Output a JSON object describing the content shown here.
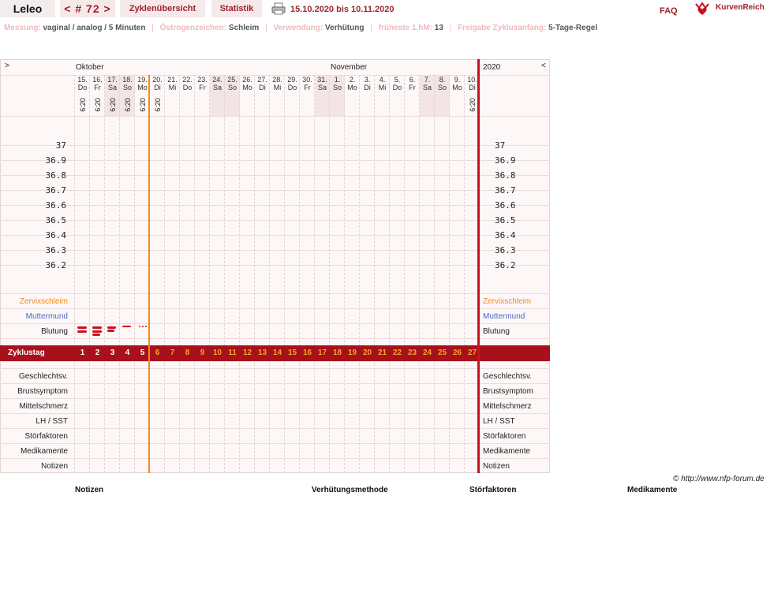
{
  "nav": {
    "user": "Leleo",
    "cycle": "< # 72 >",
    "overview": "Zyklenübersicht",
    "stats": "Statistik",
    "date_range": "15.10.2020 bis 10.11.2020",
    "faq": "FAQ",
    "logo": "KurvenReich"
  },
  "info": [
    {
      "key": "Messung:",
      "value": "vaginal / analog / 5 Minuten"
    },
    {
      "key": "Östrogenzeichen:",
      "value": "Schleim"
    },
    {
      "key": "Verwendung:",
      "value": "Verhütung"
    },
    {
      "key": "früheste 1.hM:",
      "value": "13"
    },
    {
      "key": "Freigabe Zyklusanfang:",
      "value": "5-Tage-Regel"
    }
  ],
  "chart": {
    "nav_left": ">",
    "nav_right": "<",
    "month1": "Oktober",
    "month2": "November",
    "year": "2020",
    "days": [
      {
        "n": "15.",
        "w": "Do",
        "t": "6:20"
      },
      {
        "n": "16.",
        "w": "Fr",
        "t": "6:20"
      },
      {
        "n": "17.",
        "w": "Sa",
        "t": "6:20"
      },
      {
        "n": "18.",
        "w": "So",
        "t": "6:20"
      },
      {
        "n": "19.",
        "w": "Mo",
        "t": "6:20"
      },
      {
        "n": "20.",
        "w": "Di",
        "t": "6:20"
      },
      {
        "n": "21.",
        "w": "Mi",
        "t": ""
      },
      {
        "n": "22.",
        "w": "Do",
        "t": ""
      },
      {
        "n": "23.",
        "w": "Fr",
        "t": ""
      },
      {
        "n": "24.",
        "w": "Sa",
        "t": ""
      },
      {
        "n": "25.",
        "w": "So",
        "t": ""
      },
      {
        "n": "26.",
        "w": "Mo",
        "t": ""
      },
      {
        "n": "27.",
        "w": "Di",
        "t": ""
      },
      {
        "n": "28.",
        "w": "Mi",
        "t": ""
      },
      {
        "n": "29.",
        "w": "Do",
        "t": ""
      },
      {
        "n": "30.",
        "w": "Fr",
        "t": ""
      },
      {
        "n": "31.",
        "w": "Sa",
        "t": ""
      },
      {
        "n": "1.",
        "w": "So",
        "t": ""
      },
      {
        "n": "2.",
        "w": "Mo",
        "t": ""
      },
      {
        "n": "3.",
        "w": "Di",
        "t": ""
      },
      {
        "n": "4.",
        "w": "Mi",
        "t": ""
      },
      {
        "n": "5.",
        "w": "Do",
        "t": ""
      },
      {
        "n": "6.",
        "w": "Fr",
        "t": ""
      },
      {
        "n": "7.",
        "w": "Sa",
        "t": ""
      },
      {
        "n": "8.",
        "w": "So",
        "t": ""
      },
      {
        "n": "9.",
        "w": "Mo",
        "t": ""
      },
      {
        "n": "10.",
        "w": "Di",
        "t": "6:20"
      }
    ],
    "temps": [
      "37",
      "36.9",
      "36.8",
      "36.7",
      "36.6",
      "36.5",
      "36.4",
      "36.3",
      "36.2"
    ],
    "rows_top": [
      {
        "label": "Zervixschleim",
        "color": "#f08a1e"
      },
      {
        "label": "Muttermund",
        "color": "#4a6acb"
      },
      {
        "label": "Blutung",
        "color": "#222"
      }
    ],
    "zyklustag_label": "Zyklustag",
    "cycle_days": [
      "1",
      "2",
      "3",
      "4",
      "5",
      "6",
      "7",
      "8",
      "9",
      "10",
      "11",
      "12",
      "13",
      "14",
      "15",
      "16",
      "17",
      "18",
      "19",
      "20",
      "21",
      "22",
      "23",
      "24",
      "25",
      "26",
      "27"
    ],
    "rows_bottom": [
      "Geschlechtsv.",
      "Brustsymptom",
      "Mittelschmerz",
      "LH / SST",
      "Störfaktoren",
      "Medikamente",
      "Notizen"
    ],
    "bleeding": [
      {
        "day": 1,
        "level": "heavy"
      },
      {
        "day": 2,
        "level": "heavy"
      },
      {
        "day": 3,
        "level": "medium"
      },
      {
        "day": 4,
        "level": "light"
      },
      {
        "day": 5,
        "level": "spotting"
      }
    ]
  },
  "credit": "© http://www.nfp-forum.de",
  "footer": [
    "Notizen",
    "Verhütungsmethode",
    "Störfaktoren",
    "Medikamente"
  ]
}
